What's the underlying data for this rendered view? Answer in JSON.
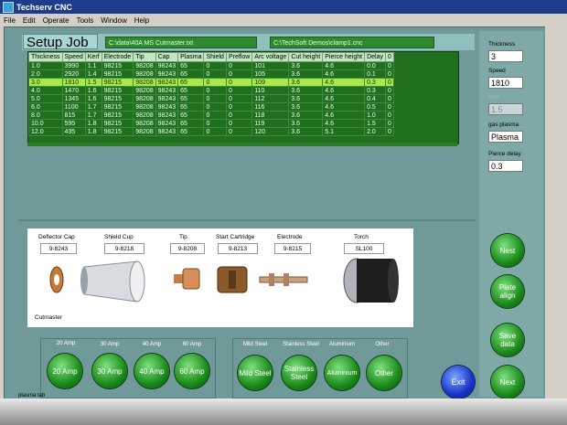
{
  "window": {
    "title": "Techserv CNC"
  },
  "menu": [
    "File",
    "Edit",
    "Operate",
    "Tools",
    "Window",
    "Help"
  ],
  "setup_label": "Setup Job",
  "paths": {
    "cutfile": "C:\\data\\40A MS Cutmaster.txt",
    "cncfile": "C:\\TechSoft Demos\\clamp1.cnc"
  },
  "table": {
    "headers": [
      "Thickness",
      "Speed",
      "Kerf",
      "Electrode",
      "Tip",
      "Cap",
      "Plasma",
      "Shield",
      "Preflow",
      "Arc voltage",
      "Cut height",
      "Pierce height",
      "Delay",
      "0"
    ],
    "rows": [
      [
        "1.0",
        "3990",
        "1.1",
        "98215",
        "98208",
        "98243",
        "65",
        "0",
        "0",
        "101",
        "3.6",
        "4.6",
        "0.0",
        "0"
      ],
      [
        "2.0",
        "2920",
        "1.4",
        "98215",
        "98208",
        "98243",
        "65",
        "0",
        "0",
        "105",
        "3.6",
        "4.6",
        "0.1",
        "0"
      ],
      [
        "3.0",
        "1810",
        "1.5",
        "98215",
        "98208",
        "98243",
        "65",
        "0",
        "0",
        "109",
        "3.6",
        "4.6",
        "0.3",
        "0"
      ],
      [
        "4.0",
        "1470",
        "1.6",
        "98215",
        "98208",
        "98243",
        "65",
        "0",
        "0",
        "110",
        "3.6",
        "4.6",
        "0.3",
        "0"
      ],
      [
        "5.0",
        "1345",
        "1.6",
        "98215",
        "98208",
        "98243",
        "65",
        "0",
        "0",
        "112",
        "3.6",
        "4.6",
        "0.4",
        "0"
      ],
      [
        "6.0",
        "1100",
        "1.7",
        "98215",
        "98208",
        "98243",
        "65",
        "0",
        "0",
        "116",
        "3.6",
        "4.6",
        "0.5",
        "0"
      ],
      [
        "8.0",
        "815",
        "1.7",
        "98215",
        "98208",
        "98243",
        "65",
        "0",
        "0",
        "118",
        "3.6",
        "4.6",
        "1.0",
        "0"
      ],
      [
        "10.0",
        "595",
        "1.8",
        "98215",
        "98208",
        "98243",
        "65",
        "0",
        "0",
        "119",
        "3.6",
        "4.6",
        "1.5",
        "0"
      ],
      [
        "12.0",
        "435",
        "1.8",
        "98215",
        "98208",
        "98243",
        "65",
        "0",
        "0",
        "120",
        "3.6",
        "5.1",
        "2.0",
        "0"
      ]
    ],
    "highlight_row": 2
  },
  "parts": {
    "deflector_cap": {
      "label": "Deflector Cap",
      "code": "9-8243"
    },
    "shield_cup": {
      "label": "Shield Cup",
      "code": "9-8218"
    },
    "tip": {
      "label": "Tip",
      "code": "9-8208"
    },
    "start_cartridge": {
      "label": "Start Cartridge",
      "code": "9-8213"
    },
    "electrode": {
      "label": "Electrode",
      "code": "9-8215"
    },
    "torch": {
      "label": "Torch",
      "code": "SL100"
    },
    "brand": "Cutmaster"
  },
  "amps": {
    "labels": [
      "20 Amp",
      "30 Amp",
      "40 Amp",
      "60 Amp"
    ],
    "buttons": [
      "20 Amp",
      "30 Amp",
      "40 Amp",
      "60 Amp"
    ]
  },
  "materials": {
    "labels": [
      "Mild Steel",
      "Stainless Steel",
      "Aluminium",
      "Other"
    ],
    "buttons": [
      "Mild Steel",
      "Stainless Steel",
      "Aluminium",
      "Other"
    ]
  },
  "right": {
    "thickness_label": "Thickness",
    "thickness_value": "3",
    "speed_label": "Speed",
    "speed_value": "1810",
    "kerf_label": "Kerf",
    "kerf_value": "1.5",
    "gas_label": "gas plasma",
    "gas_value": "Plasma",
    "pierce_label": "Pierce delay",
    "pierce_value": "0.3"
  },
  "buttons": {
    "nest": "Nest",
    "plate_align": "Plate align",
    "save_data": "Save data",
    "next": "Next",
    "exit": "Exit"
  },
  "footer": "plasma tab"
}
